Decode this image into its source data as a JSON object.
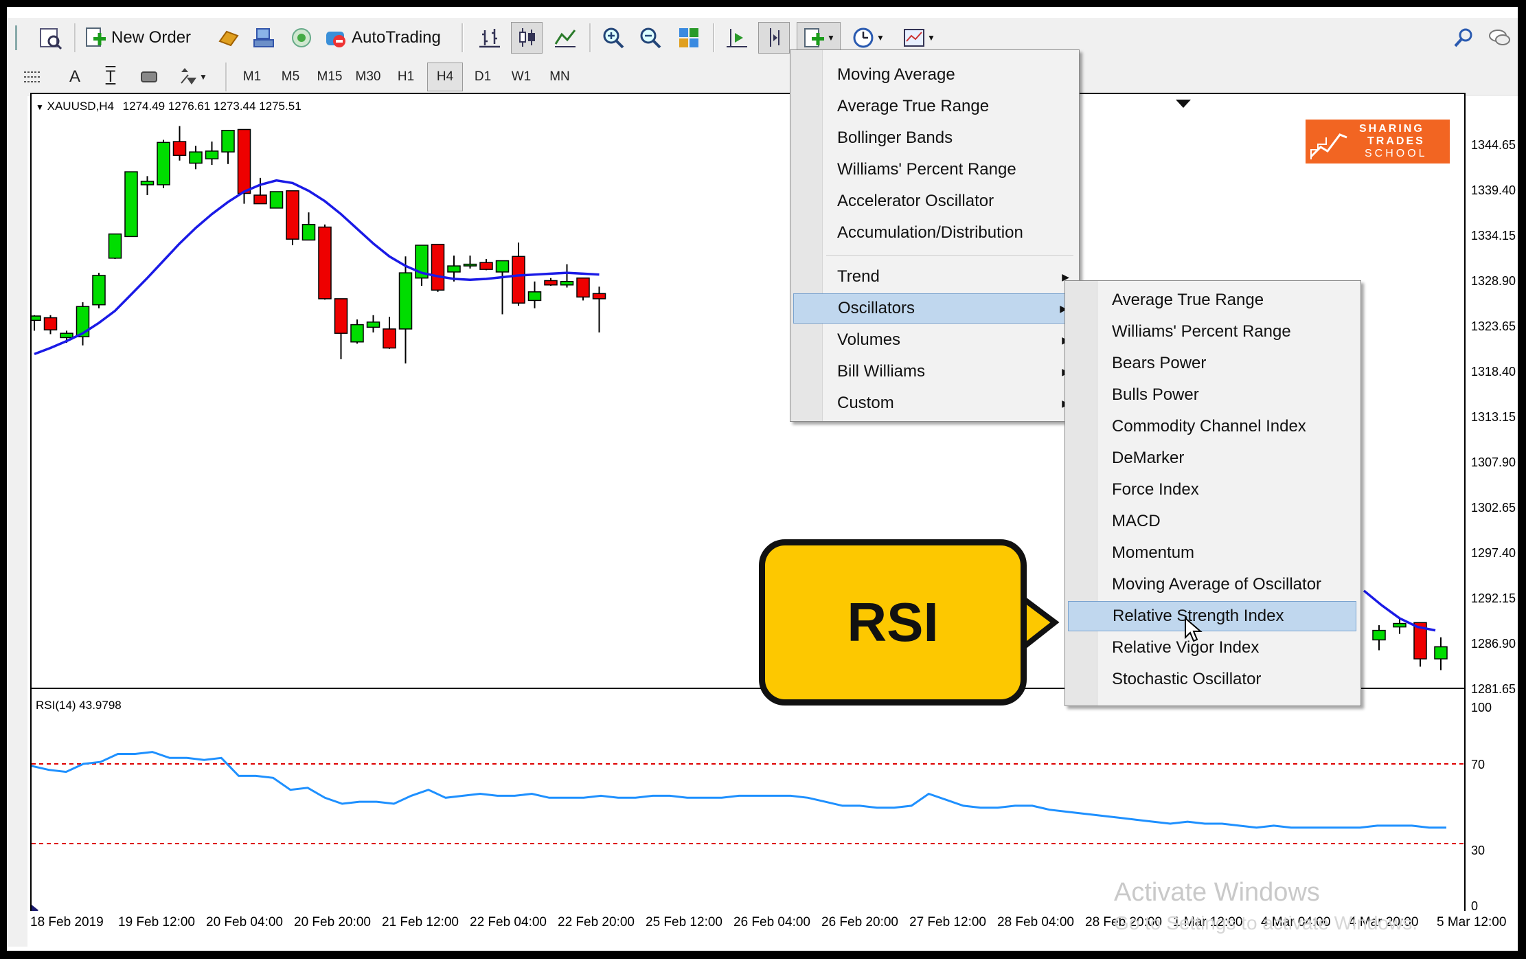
{
  "toolbar": {
    "new_order_label": "New Order",
    "autotrading_label": "AutoTrading"
  },
  "timeframes": [
    "M1",
    "M5",
    "M15",
    "M30",
    "H1",
    "H4",
    "D1",
    "W1",
    "MN"
  ],
  "timeframe_selected": "H4",
  "drawing_tools": {
    "text_label": "A",
    "text_label_tool": "T"
  },
  "chart": {
    "symbol_header": "XAUUSD,H4",
    "ohlc": "1274.49 1276.61 1273.44 1275.51",
    "price_axis": [
      "1344.65",
      "1339.40",
      "1334.15",
      "1328.90",
      "1323.65",
      "1318.40",
      "1313.15",
      "1307.90",
      "1302.65",
      "1297.40",
      "1292.15",
      "1286.90",
      "1281.65"
    ],
    "time_axis": [
      "18 Feb 2019",
      "19 Feb 12:00",
      "20 Feb 04:00",
      "20 Feb 20:00",
      "21 Feb 12:00",
      "22 Feb 04:00",
      "22 Feb 20:00",
      "25 Feb 12:00",
      "26 Feb 04:00",
      "26 Feb 20:00",
      "27 Feb 12:00",
      "28 Feb 04:00",
      "28 Feb 20:00",
      "1 Mar 12:00",
      "4 Mar 04:00",
      "4 Mar 20:00",
      "5 Mar 12:00"
    ],
    "colors": {
      "bull": "#00dd00",
      "bear": "#ee0000",
      "ma": "#1a1ae6",
      "rsi": "#1e90ff",
      "levels": "#dd0000"
    }
  },
  "logo": {
    "line1": "SHARING",
    "line2": "TRADES",
    "line3": "SCHOOL",
    "color": "#f26522"
  },
  "rsi": {
    "label": "RSI(14) 43.9798",
    "axis": [
      "100",
      "70",
      "30",
      "0"
    ],
    "values": [
      69,
      67,
      66,
      70,
      71,
      75,
      75,
      76,
      73,
      73,
      72,
      73,
      64,
      64,
      63,
      57,
      58,
      53,
      50,
      51,
      51,
      50,
      54,
      57,
      53,
      54,
      55,
      54,
      54,
      55,
      53,
      53,
      53,
      54,
      53,
      53,
      54,
      54,
      53,
      53,
      53,
      54,
      54,
      54,
      54,
      53,
      51,
      49,
      49,
      48,
      48,
      49,
      55,
      52,
      49,
      48,
      48,
      49,
      49,
      47,
      46,
      45,
      44,
      43,
      42,
      41,
      40,
      41,
      40,
      40,
      39,
      38,
      39,
      38,
      38,
      38,
      38,
      38,
      39,
      39,
      39,
      38,
      38
    ]
  },
  "menu_indicators": {
    "items": [
      "Moving Average",
      "Average True Range",
      "Bollinger Bands",
      "Williams' Percent Range",
      "Accelerator Oscillator",
      "Accumulation/Distribution"
    ],
    "groups": [
      "Trend",
      "Oscillators",
      "Volumes",
      "Bill Williams",
      "Custom"
    ],
    "highlighted": "Oscillators"
  },
  "menu_oscillators": {
    "items": [
      "Average True Range",
      "Williams' Percent Range",
      "Bears Power",
      "Bulls Power",
      "Commodity Channel Index",
      "DeMarker",
      "Force Index",
      "MACD",
      "Momentum",
      "Moving Average of Oscillator",
      "Relative Strength Index",
      "Relative Vigor Index",
      "Stochastic Oscillator"
    ],
    "highlighted": "Relative Strength Index"
  },
  "callout": {
    "text": "RSI"
  },
  "watermark": {
    "line1": "Activate Windows",
    "line2": "Go to Settings to activate Windows."
  },
  "icons": [
    "market-watch-icon",
    "data-window-icon",
    "new-order-icon",
    "history-icon",
    "signals-icon",
    "autotrading-icon",
    "bar-chart-icon",
    "candlestick-icon",
    "line-chart-icon",
    "zoom-in-icon",
    "zoom-out-icon",
    "tile-windows-icon",
    "shift-end-icon",
    "autoscroll-icon",
    "indicators-icon",
    "periods-icon",
    "templates-icon",
    "search-icon",
    "chat-icon"
  ]
}
